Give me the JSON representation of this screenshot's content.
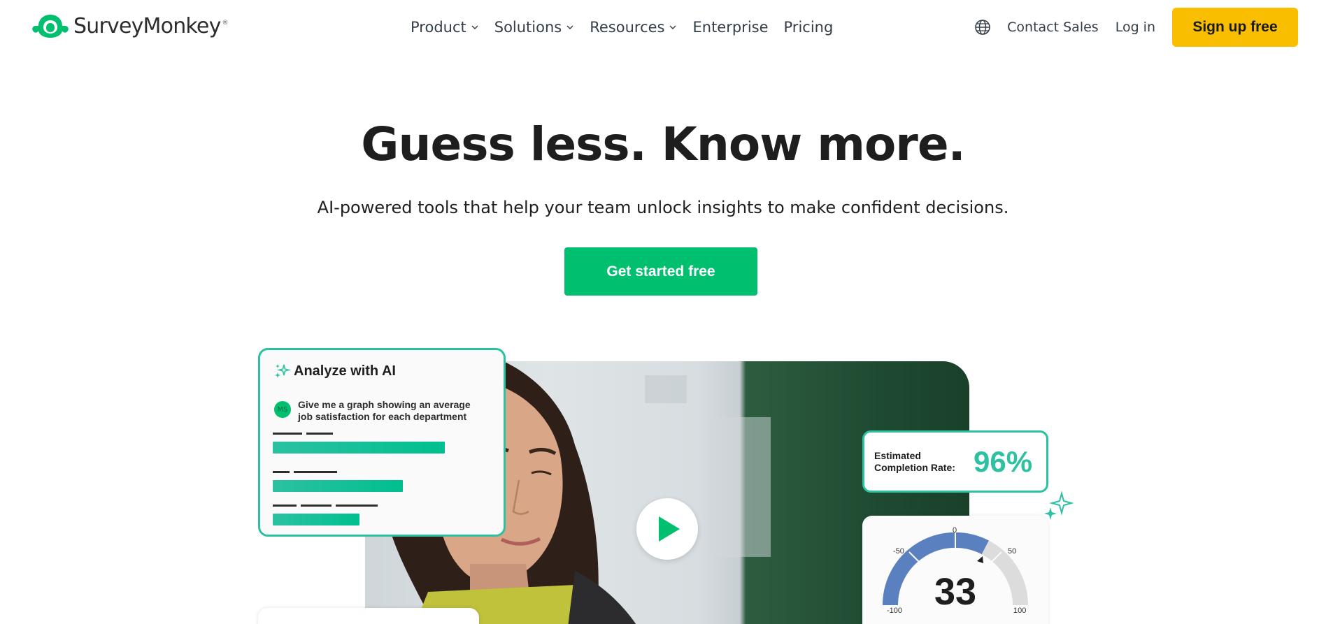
{
  "brand": {
    "name": "SurveyMonkey",
    "registered": "®",
    "logo_color": "#00bf6f"
  },
  "nav": {
    "links": [
      {
        "label": "Product",
        "dropdown": true
      },
      {
        "label": "Solutions",
        "dropdown": true
      },
      {
        "label": "Resources",
        "dropdown": true
      },
      {
        "label": "Enterprise",
        "dropdown": false
      },
      {
        "label": "Pricing",
        "dropdown": false
      }
    ],
    "language_icon": "globe-icon",
    "contact_sales": "Contact Sales",
    "login": "Log in",
    "signup": "Sign up free",
    "signup_color": "#f9be00"
  },
  "hero": {
    "headline": "Guess less. Know more.",
    "subhead": "AI-powered tools that help your team unlock insights to make confident decisions.",
    "cta": "Get started free",
    "cta_color": "#00bf6f"
  },
  "ai_card": {
    "title": "Analyze with AI",
    "avatar_initials": "MS",
    "prompt": "Give me a graph showing an average job satisfaction for each department",
    "accent": "#2cc1a1"
  },
  "completion_card": {
    "label": "Estimated Completion Rate:",
    "value": "96%"
  },
  "gauge_card": {
    "value": "33",
    "ticks": [
      "-100",
      "-50",
      "0",
      "50",
      "100"
    ],
    "color": "#5b80c0"
  },
  "video": {
    "play_icon": "play-icon"
  }
}
